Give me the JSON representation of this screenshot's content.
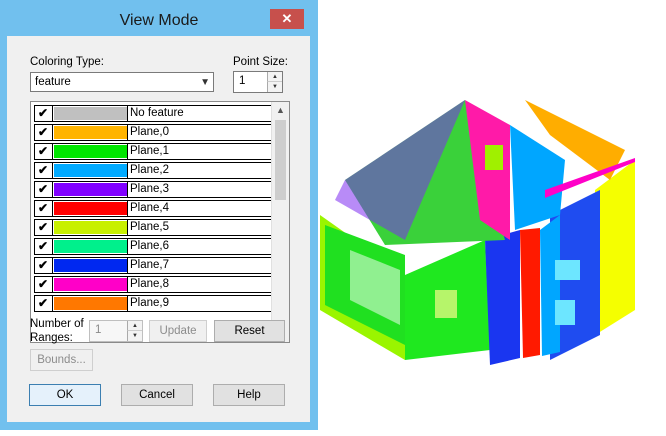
{
  "dialog": {
    "title": "View Mode",
    "close_label": "✕"
  },
  "coloring": {
    "label": "Coloring Type:",
    "value": "feature",
    "dropdown_arrow": "▼"
  },
  "point_size": {
    "label": "Point Size:",
    "value": "1"
  },
  "features": [
    {
      "label": "No feature",
      "color": "#c0c0c0",
      "checked": true
    },
    {
      "label": "Plane,0",
      "color": "#ffb400",
      "checked": true
    },
    {
      "label": "Plane,1",
      "color": "#00e600",
      "checked": true
    },
    {
      "label": "Plane,2",
      "color": "#00aaff",
      "checked": true
    },
    {
      "label": "Plane,3",
      "color": "#8000ff",
      "checked": true
    },
    {
      "label": "Plane,4",
      "color": "#ff0000",
      "checked": true
    },
    {
      "label": "Plane,5",
      "color": "#c8f000",
      "checked": true
    },
    {
      "label": "Plane,6",
      "color": "#00f08c",
      "checked": true
    },
    {
      "label": "Plane,7",
      "color": "#0028f0",
      "checked": true
    },
    {
      "label": "Plane,8",
      "color": "#ff00c8",
      "checked": true
    },
    {
      "label": "Plane,9",
      "color": "#ff7800",
      "checked": true
    }
  ],
  "ranges": {
    "label_line1": "Number of",
    "label_line2": "Ranges:",
    "value": "1"
  },
  "buttons": {
    "update": "Update",
    "reset": "Reset",
    "bounds": "Bounds...",
    "ok": "OK",
    "cancel": "Cancel",
    "help": "Help"
  }
}
